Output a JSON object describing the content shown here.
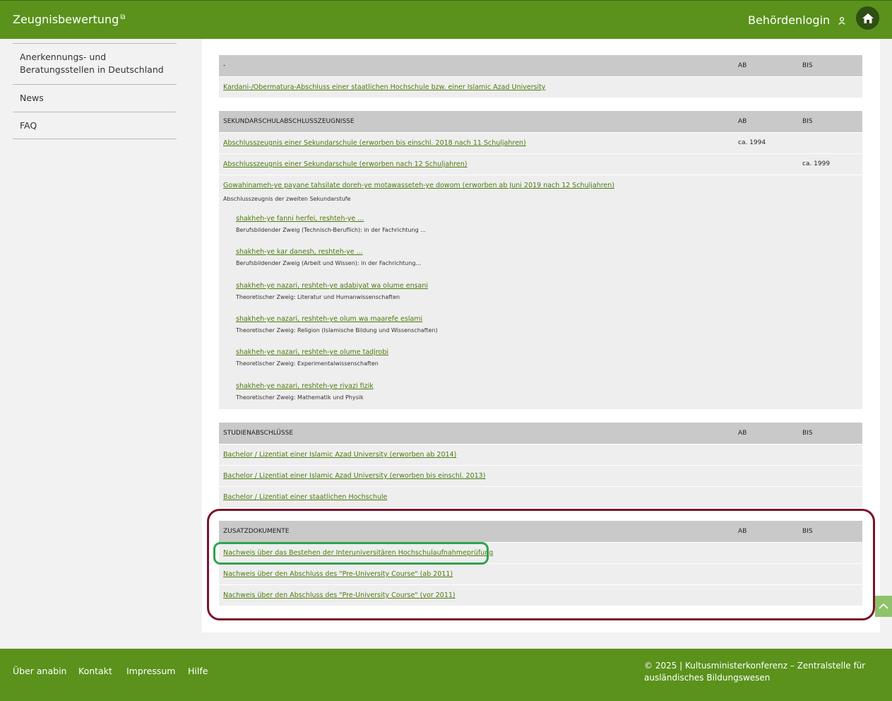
{
  "header": {
    "brand": "Zeugnisbewertung",
    "brand_icon": "external-link-icon",
    "login": "Behördenlogin",
    "login_icon": "user-icon",
    "home_icon": "home-icon"
  },
  "sidebar": {
    "items": [
      {
        "label": "Anerkennungs- und Beratungsstellen in Deutschland"
      },
      {
        "label": "News"
      },
      {
        "label": "FAQ"
      }
    ]
  },
  "sections": {
    "s0": {
      "title": "-",
      "ab": "AB",
      "bis": "BIS",
      "rows": [
        {
          "link": "Kardani-/Obermatura-Abschluss einer staatlichen Hochschule bzw. einer Islamic Azad University",
          "ab": "",
          "bis": ""
        }
      ]
    },
    "s1": {
      "title": "SEKUNDARSCHULABSCHLUSSZEUGNISSE",
      "ab": "AB",
      "bis": "BIS",
      "rows": [
        {
          "link": "Abschlusszeugnis einer Sekundarschule (erworben bis einschl. 2018 nach 11 Schuljahren)",
          "ab": "ca. 1994",
          "bis": ""
        },
        {
          "link": "Abschlusszeugnis einer Sekundarschule (erworben nach 12 Schuljahren)",
          "ab": "",
          "bis": "ca. 1999"
        }
      ],
      "group": {
        "link": "Gowahinameh-ye payane tahsilate doreh-ye motawasseteh-ye dowom (erworben ab Juni 2019 nach 12 Schuljahren)",
        "desc": "Abschlusszeugnis der zweiten Sekundarstufe",
        "subs": [
          {
            "link": "shakheh-ye fanni herfei, reshteh-ye ...",
            "desc": "Berufsbildender Zweig (Technisch-Beruflich): in der Fachrichtung ..."
          },
          {
            "link": "shakheh-ye kar danesh, reshteh-ye ...",
            "desc": "Berufsbildender Zweig (Arbeit und Wissen): in der Fachrichtung..."
          },
          {
            "link": "shakheh-ye nazari, reshteh-ye adabiyat wa olume ensani",
            "desc": "Theoretischer Zweig: Literatur und Humanwissenschaften"
          },
          {
            "link": "shakheh-ye nazari, reshteh-ye olum wa maarefe eslami",
            "desc": "Theoretischer Zweig: Religion (Islamische Bildung und Wissenschaften)"
          },
          {
            "link": "shakheh-ye nazari, reshteh-ye olume tadjrobi",
            "desc": "Theoretischer Zweig: Experimentalwissenschaften"
          },
          {
            "link": "shakheh-ye nazari, reshteh-ye riyazi fizik",
            "desc": "Theoretischer Zweig: Mathematik und Physik"
          }
        ]
      }
    },
    "s2": {
      "title": "STUDIENABSCHLÜSSE",
      "ab": "AB",
      "bis": "BIS",
      "rows": [
        {
          "link": "Bachelor / Lizentiat einer Islamic Azad University (erworben ab 2014)"
        },
        {
          "link": "Bachelor / Lizentiat einer Islamic Azad University (erworben bis einschl. 2013)"
        },
        {
          "link": "Bachelor / Lizentiat einer staatlichen Hochschule"
        }
      ]
    },
    "s3": {
      "title": "ZUSATZDOKUMENTE",
      "ab": "AB",
      "bis": "BIS",
      "rows": [
        {
          "link": "Nachweis über das Bestehen der Interuniversitären Hochschulaufnahmeprüfung"
        },
        {
          "link": "Nachweis über den Abschluss des \"Pre-University Course\" (ab 2011)"
        },
        {
          "link": "Nachweis über den Abschluss des \"Pre-University Course\" (vor 2011)"
        }
      ]
    }
  },
  "footer": {
    "links": [
      "Über anabin",
      "Kontakt",
      "Impressum",
      "Hilfe"
    ],
    "copyright": "© 2025 | Kultusministerkonferenz – Zentralstelle für ausländisches Bildungswesen"
  },
  "scroll_top_icon": "chevron-up-icon",
  "colors": {
    "brand_green": "#5a921c",
    "link_green": "#4d7a0f",
    "annotation_red": "#7a1329",
    "annotation_green": "#2ea44f"
  }
}
